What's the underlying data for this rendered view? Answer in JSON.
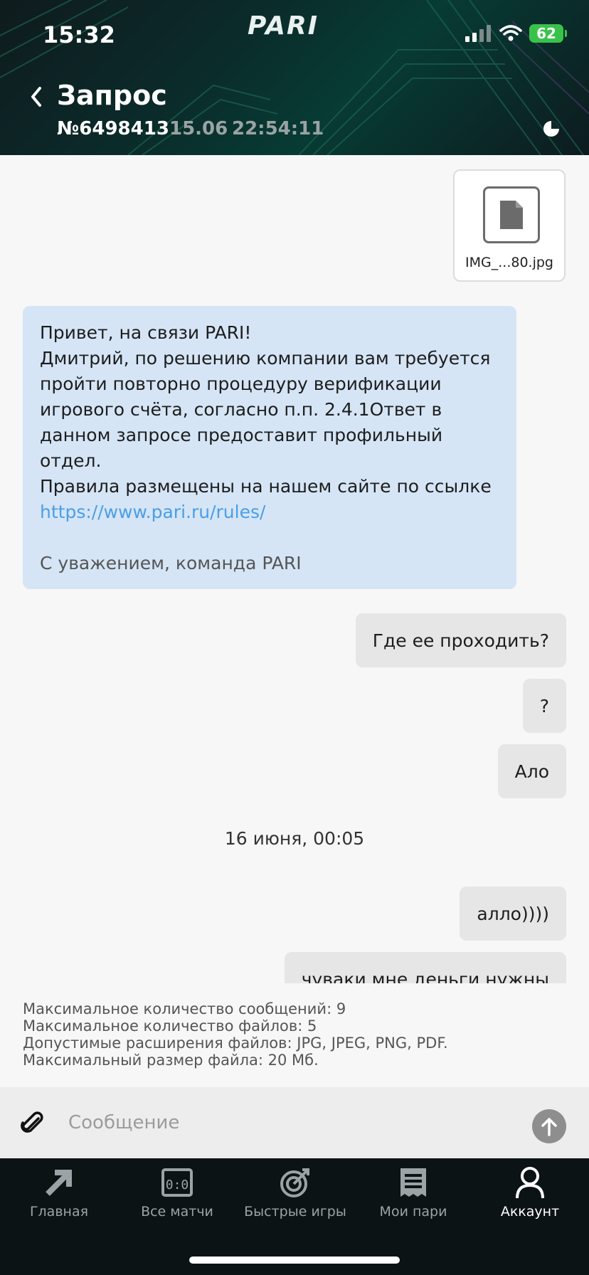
{
  "status_bar": {
    "time": "15:32",
    "battery": "62"
  },
  "brand": {
    "logo_text": "PARI"
  },
  "header": {
    "title": "Запрос",
    "request_number": "№6498413",
    "date": "15.06",
    "time": "22:54:11"
  },
  "attachment": {
    "file_name": "IMG_...80.jpg",
    "icon": "file-icon"
  },
  "incoming_message": {
    "lines": [
      "Привет, на связи PARI!",
      "Дмитрий, по решению компании вам требуется",
      "пройти повторно процедуру верификации",
      "игрового счёта, согласно п.п. 2.4.1Ответ в",
      "данном запросе предоставит профильный",
      "отдел.",
      "Правила размещены на нашем сайте по ссылке"
    ],
    "link": "https://www.pari.ru/rules/",
    "signature": "С уважением, команда PARI"
  },
  "outgoing_messages": [
    "Где ее проходить?",
    "?",
    "Ало",
    "алло))))",
    "чуваки мне деньги нужны"
  ],
  "date_separator": "16 июня, 00:05",
  "limits": [
    "Максимальное количество сообщений: 9",
    "Максимальное количество файлов: 5",
    "Допустимые расширения файлов: JPG, JPEG, PNG, PDF.",
    "Максимальный размер файла: 20 Мб."
  ],
  "composer": {
    "placeholder": "Сообщение"
  },
  "tabs": [
    {
      "label": "Главная",
      "icon": "arrow-home-icon"
    },
    {
      "label": "Все матчи",
      "icon": "scoreboard-icon"
    },
    {
      "label": "Быстрые игры",
      "icon": "target-icon"
    },
    {
      "label": "Мои пари",
      "icon": "coupon-icon"
    },
    {
      "label": "Аккаунт",
      "icon": "user-icon",
      "active": true
    }
  ],
  "colors": {
    "accent_link": "#4a9fe6",
    "incoming_bubble": "#d5e5f6",
    "outgoing_bubble": "#e6e6e6",
    "tabbar": "#0c1315"
  }
}
